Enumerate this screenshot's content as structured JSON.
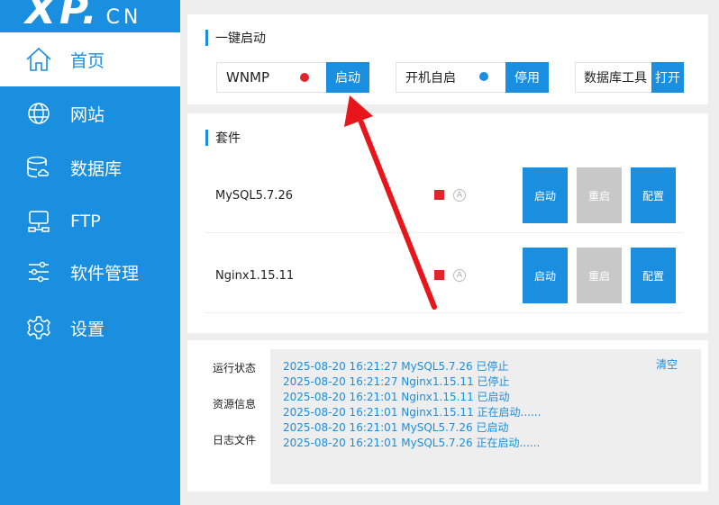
{
  "logo": {
    "main": "XP.",
    "sub": "CN"
  },
  "sidebar": {
    "items": [
      {
        "label": "首页",
        "icon": "home-icon"
      },
      {
        "label": "网站",
        "icon": "globe-icon"
      },
      {
        "label": "数据库",
        "icon": "database-icon"
      },
      {
        "label": "FTP",
        "icon": "ftp-server-icon"
      },
      {
        "label": "软件管理",
        "icon": "sliders-icon"
      },
      {
        "label": "设置",
        "icon": "gear-icon"
      }
    ]
  },
  "quickstart": {
    "title": "一键启动",
    "wnmp": {
      "name": "WNMP",
      "button": "启动",
      "status_color": "#e0262c"
    },
    "autostart": {
      "name": "开机自启",
      "button": "停用",
      "status_color": "#1a8fe0"
    },
    "dbtool": {
      "name": "数据库工具",
      "button": "打开"
    }
  },
  "packages": {
    "title": "套件",
    "rows": [
      {
        "name": "MySQL5.7.26",
        "auto": "A",
        "start": "启动",
        "restart": "重启",
        "config": "配置"
      },
      {
        "name": "Nginx1.15.11",
        "auto": "A",
        "start": "启动",
        "restart": "重启",
        "config": "配置"
      }
    ]
  },
  "log": {
    "tabs": [
      "运行状态",
      "资源信息",
      "日志文件"
    ],
    "clear": "清空",
    "lines": [
      "2025-08-20 16:21:27 MySQL5.7.26 已停止",
      "2025-08-20 16:21:27 Nginx1.15.11 已停止",
      "2025-08-20 16:21:01 Nginx1.15.11 已启动",
      "2025-08-20 16:21:01 Nginx1.15.11 正在启动......",
      "2025-08-20 16:21:01 MySQL5.7.26 已启动",
      "2025-08-20 16:21:01 MySQL5.7.26 正在启动......"
    ]
  },
  "colors": {
    "accent": "#1a8fe0",
    "stopped": "#e0262c",
    "annotation_arrow": "#e8161b"
  }
}
